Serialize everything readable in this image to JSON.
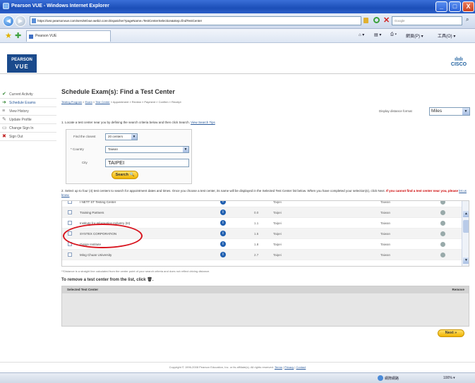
{
  "window": {
    "title": "Pearson VUE - Windows Internet Explorer",
    "min": "_",
    "max": "□",
    "close": "X"
  },
  "browser": {
    "url": "https://wsr.pearsonvue.com/servlet/vue.web2.core.Dispatcher?pageName=TestCenterSelection&step=findTestCenter",
    "search_placeholder": "Google",
    "tab_title": "Pearson VUE",
    "home": "⌂ ▾",
    "feeds": "▤ ▾",
    "print": "⎙ ▾",
    "page_menu": "網頁(P) ▾",
    "tools_menu": "工具(O) ▾",
    "back": "◀",
    "forward": "▶",
    "stop": "✕",
    "search_go": "⌕"
  },
  "header": {
    "pearson_line1": "PEARSON",
    "pearson_line2": "VUE",
    "cisco_bars": "ılıılı",
    "cisco_text": "CISCO"
  },
  "sidebar": {
    "items": [
      {
        "label": "Current Activity",
        "icon": "✔"
      },
      {
        "label": "Schedule Exams",
        "icon": "➜"
      },
      {
        "label": "View History",
        "icon": "≡"
      },
      {
        "label": "Update Profile",
        "icon": "✎"
      },
      {
        "label": "Change Sign In",
        "icon": "▭"
      },
      {
        "label": "Sign Out",
        "icon": "✖"
      }
    ]
  },
  "main": {
    "title": "Schedule Exam(s): Find a Test Center",
    "breadcrumbs": {
      "b1": "Testing Program",
      "b2": "Exam",
      "b3": "Test Center",
      "rest": " » Appointment » Review » Payment » Confirm » Receipt",
      "sep": " » "
    },
    "display_format_label": "Display distance format",
    "display_format_value": "Miles",
    "dropdown_arrow": "▼",
    "step1_text": "1. Locate a test center near you by defining the search criteria below and then click Search.",
    "step1_link": "View Search Tips",
    "find_closest_label": "Find the closest",
    "find_closest_value": "20 centers",
    "country_label": "* Country",
    "country_value": "Taiwan",
    "city_label": "City",
    "city_value": "TAIPEI",
    "search_button": "Search 🔍",
    "step2_text": "2. Select up to four (4) test centers to search for appointment dates and times. Once you choose a test center, its name will be displayed in the Selected Test Center list below. When you have completed your selection(s), click Next.",
    "step2_warn": "If you cannot find a test center near you, please",
    "step2_link": "let us know.",
    "results": [
      {
        "name": "I NETT ST Testing Center",
        "distance": "",
        "city": "Taipei",
        "country": "Taiwan"
      },
      {
        "name": "Training Partners",
        "distance": "0.0",
        "city": "Taipei",
        "country": "Taiwan"
      },
      {
        "name": "Institute for Information Industry (III)",
        "distance": "1.1",
        "city": "Taipei",
        "country": "Taiwan"
      },
      {
        "name": "SYSTEX CORPORATION",
        "distance": "1.5",
        "city": "Taipei",
        "country": "Taiwan"
      },
      {
        "name": "Gieign Institute",
        "distance": "1.8",
        "city": "Taipei",
        "country": "Taiwan"
      },
      {
        "name": "Ming Chuan University",
        "distance": "2.7",
        "city": "Taipei",
        "country": "Taiwan"
      }
    ],
    "info_glyph": "i",
    "scroll_up": "▲",
    "scroll_down": "▼",
    "footnote": "**Distance is a straight line calculated from the center point of your search criteria and does not reflect driving distance.",
    "remove_title": "To remove a test center from the list, click 🗑.",
    "selected_header": "Selected Test Center",
    "remove_header": "Remove",
    "next_button": "Next »"
  },
  "footer": {
    "copyright": "Copyright © 1996-2008 Pearson Education, Inc. or its affiliate(s). All rights reserved.",
    "terms": "Terms",
    "privacy": "Privacy",
    "contact": "Contact",
    "sep": " | "
  },
  "status": {
    "zone": "網際網路",
    "zoom": "100%  ▾"
  },
  "colors": {
    "titlebar": "#1c4fb8",
    "link": "#2b5b9b",
    "button": "#f0b400",
    "highlight_circle": "#d8141e"
  }
}
